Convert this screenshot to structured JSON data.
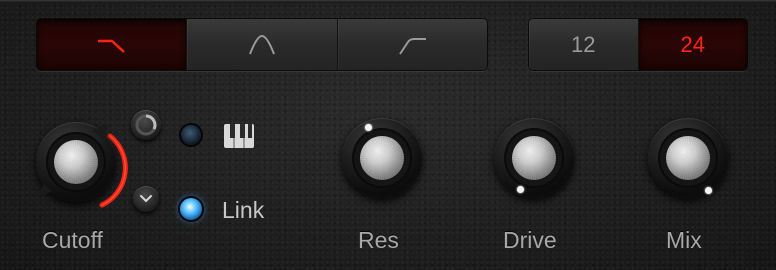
{
  "filter_type": {
    "options": [
      {
        "icon": "lowpass-filter-icon",
        "active": true
      },
      {
        "icon": "bandpass-filter-icon",
        "active": false
      },
      {
        "icon": "highpass-filter-icon",
        "active": false
      }
    ]
  },
  "slope": {
    "options": [
      {
        "label": "12",
        "active": false
      },
      {
        "label": "24",
        "active": true
      }
    ]
  },
  "cutoff": {
    "label": "Cutoff",
    "mod_amount": 0.55,
    "keytrack_icon": "piano-keys-icon",
    "link_label": "Link",
    "link_active": true,
    "keytrack_active": false
  },
  "knobs": {
    "res": {
      "label": "Res"
    },
    "drive": {
      "label": "Drive"
    },
    "mix": {
      "label": "Mix"
    }
  },
  "colors": {
    "accent_red": "#ff2414",
    "led_blue": "#4ab8ff",
    "label_gray": "#a8a8a8"
  }
}
